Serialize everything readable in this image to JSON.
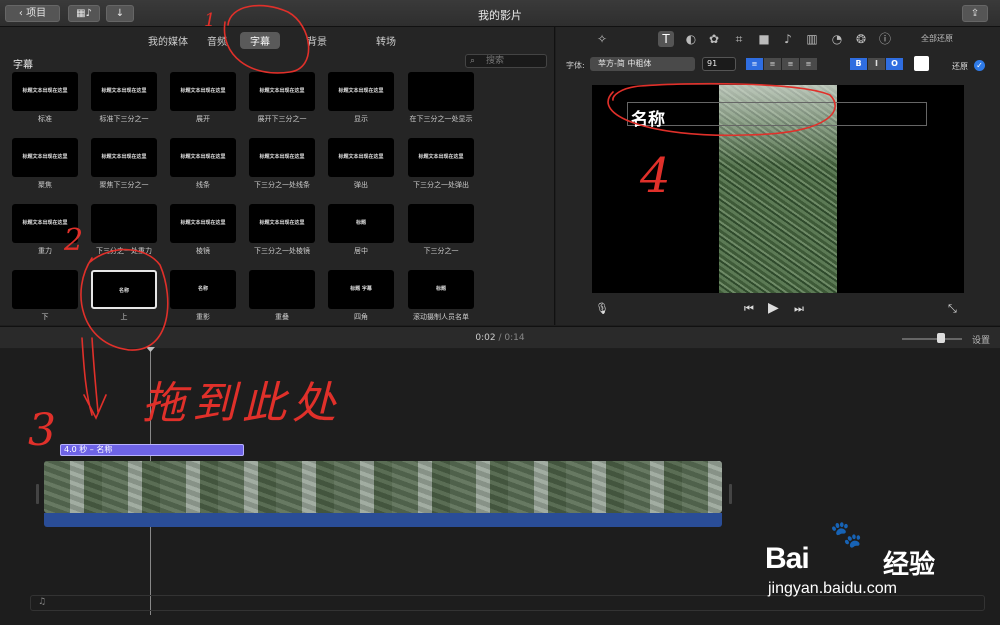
{
  "window": {
    "title": "我的影片"
  },
  "toolbar": {
    "back_label": "项目"
  },
  "browser": {
    "tabs": [
      {
        "label": "我的媒体"
      },
      {
        "label": "音频"
      },
      {
        "label": "字幕"
      },
      {
        "label": "背景"
      },
      {
        "label": "转场"
      }
    ],
    "active_tab": "字幕",
    "section_title": "字幕",
    "search_placeholder": "搜索",
    "titles": [
      {
        "label": "标准",
        "mini": "标题文本出现在这里"
      },
      {
        "label": "标准下三分之一",
        "mini": "标题文本出现在这里"
      },
      {
        "label": "展开",
        "mini": "标题文本出现在这里"
      },
      {
        "label": "展开下三分之一",
        "mini": "标题文本出现在这里"
      },
      {
        "label": "显示",
        "mini": "标题文本出现在这里"
      },
      {
        "label": "在下三分之一处显示",
        "mini": ""
      },
      {
        "label": "聚焦",
        "mini": "标题文本出现在这里"
      },
      {
        "label": "聚焦下三分之一",
        "mini": "标题文本出现在这里"
      },
      {
        "label": "线条",
        "mini": "标题文本出现在这里"
      },
      {
        "label": "下三分之一处线条",
        "mini": "标题文本出现在这里"
      },
      {
        "label": "弹出",
        "mini": "标题文本出现在这里"
      },
      {
        "label": "下三分之一处弹出",
        "mini": "标题文本出现在这里"
      },
      {
        "label": "重力",
        "mini": "标题文本出现在这里"
      },
      {
        "label": "下三分之一处重力",
        "mini": ""
      },
      {
        "label": "棱镜",
        "mini": "标题文本出现在这里"
      },
      {
        "label": "下三分之一处棱镜",
        "mini": "标题文本出现在这里"
      },
      {
        "label": "居中",
        "mini": "标题"
      },
      {
        "label": "下三分之一",
        "mini": ""
      },
      {
        "label": "下",
        "mini": ""
      },
      {
        "label": "上",
        "mini": "名称"
      },
      {
        "label": "重影",
        "mini": "名称"
      },
      {
        "label": "重叠",
        "mini": ""
      },
      {
        "label": "四角",
        "mini": "标题 字幕"
      },
      {
        "label": "滚动摄制人员名单",
        "mini": "标题"
      }
    ]
  },
  "viewer": {
    "reset_all": "全部还原",
    "font_label": "字体:",
    "font_value": "苹方-简 中粗体",
    "size_value": "91",
    "restore_label": "还原",
    "title_text": "名称",
    "style_buttons": [
      "B",
      "I",
      "O"
    ]
  },
  "timeline": {
    "current_time": "0:02",
    "total_time": "0:14",
    "settings_label": "设置",
    "title_clip_label": "4.0 秒 – 名称"
  },
  "annotations": {
    "note_1": "1",
    "note_2": "2",
    "note_3": "3",
    "note_4": "4",
    "drag_text": "拖到此处"
  },
  "watermark": {
    "logo": "Bai",
    "logo_cn": "经验",
    "url": "jingyan.baidu.com"
  },
  "colors": {
    "accent": "#2f6de0",
    "title_clip": "#6e63e6",
    "audio_track": "#2a4d97",
    "annotation": "#e0302a"
  },
  "icons": {
    "back": "chevron-left-icon",
    "media": "film-music-icon",
    "import": "arrow-down-icon",
    "share": "share-icon"
  }
}
